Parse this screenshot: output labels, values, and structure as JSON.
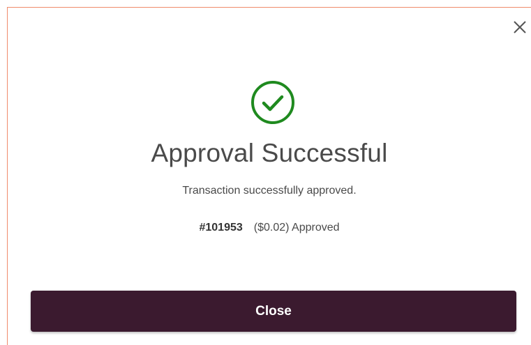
{
  "dialog": {
    "title": "Approval Successful",
    "message": "Transaction successfully approved.",
    "transaction": {
      "id": "#101953",
      "status_text": "($0.02) Approved"
    },
    "close_button_label": "Close"
  },
  "icons": {
    "close": "close-icon",
    "status": "check-circle-icon"
  },
  "colors": {
    "success_green": "#1f8a1f",
    "button_bg": "#3b1a2f",
    "border_accent": "#f08b6b",
    "text": "#4a4a4a"
  }
}
